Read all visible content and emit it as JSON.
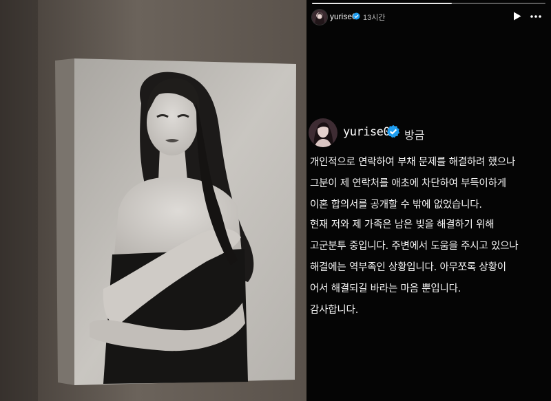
{
  "story_header": {
    "username": "yurise0",
    "time": "13시간",
    "icons": [
      "verified-badge-icon",
      "play-icon",
      "more-options-icon"
    ],
    "progress": 0.6
  },
  "post": {
    "username": "yurise0",
    "time": "방금",
    "paragraph1": [
      "개인적으로 연락하여 부채 문제를 해결하려 했으나",
      "그분이 제 연락처를 애초에 차단하여 부득이하게",
      "이혼 합의서를 공개할 수 밖에 없었습니다."
    ],
    "paragraph2": [
      "현재 저와 제 가족은 남은 빚을 해결하기 위해",
      "고군분투 중입니다. 주변에서 도움을 주시고 있으나",
      "해결에는 역부족인 상황입니다. 아무쪼록 상황이",
      "어서 해결되길 바라는 마음 뿐입니다.",
      "감사합니다."
    ]
  },
  "colors": {
    "story_background": "#050505",
    "verified_blue": "#1e9df0",
    "text": "#f4f4f4",
    "muted": "#bdbdbd"
  }
}
